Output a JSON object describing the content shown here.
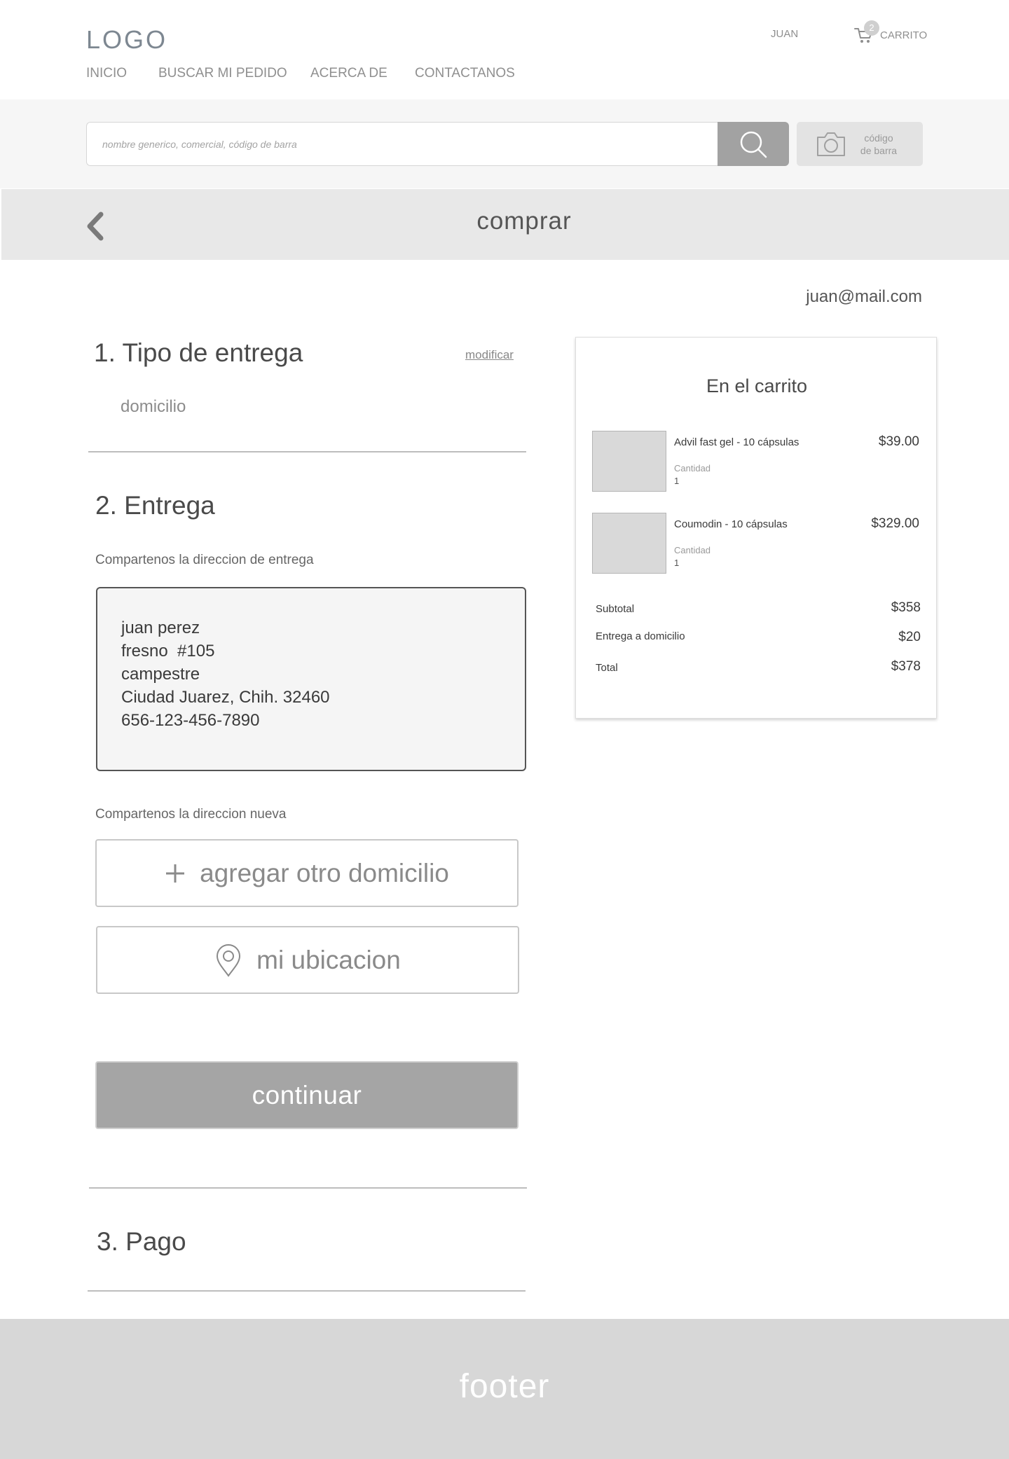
{
  "header": {
    "logo": "LOGO",
    "nav": [
      "INICIO",
      "BUSCAR MI PEDIDO",
      "ACERCA DE",
      "CONTACTANOS"
    ],
    "user": "JUAN",
    "cart_count": "2",
    "cart_label": "CARRITO"
  },
  "search": {
    "placeholder": "nombre generico, comercial, código de barra",
    "barcode_label_line1": "código",
    "barcode_label_line2": "de barra"
  },
  "page": {
    "title": "comprar",
    "email": "juan@mail.com"
  },
  "step1": {
    "title": "1. Tipo de entrega",
    "modify": "modificar",
    "value": "domicilio"
  },
  "step2": {
    "title": "2. Entrega",
    "hint_existing": "Compartenos la direccion de entrega",
    "address": [
      "juan perez",
      "fresno  #105",
      "campestre",
      "Ciudad Juarez, Chih. 32460",
      "656-123-456-7890"
    ],
    "hint_new": "Compartenos la direccion nueva",
    "add_label": "agregar otro domicilio",
    "location_label": "mi ubicacion",
    "continue_label": "continuar"
  },
  "step3": {
    "title": "3. Pago"
  },
  "cart": {
    "title": "En el carrito",
    "items": [
      {
        "name": "Advil fast gel - 10 cápsulas",
        "qty_label": "Cantidad",
        "qty": "1",
        "price": "$39.00"
      },
      {
        "name": "Coumodin - 10 cápsulas",
        "qty_label": "Cantidad",
        "qty": "1",
        "price": "$329.00"
      }
    ],
    "subtotal_label": "Subtotal",
    "subtotal": "$358",
    "delivery_label": "Entrega a domicilio",
    "delivery": "$20",
    "total_label": "Total",
    "total": "$378"
  },
  "footer": {
    "text": "footer"
  },
  "colors": {
    "primary_button": "#a5a5a5",
    "band": "#e8e8e8",
    "footer": "#d7d7d7"
  }
}
